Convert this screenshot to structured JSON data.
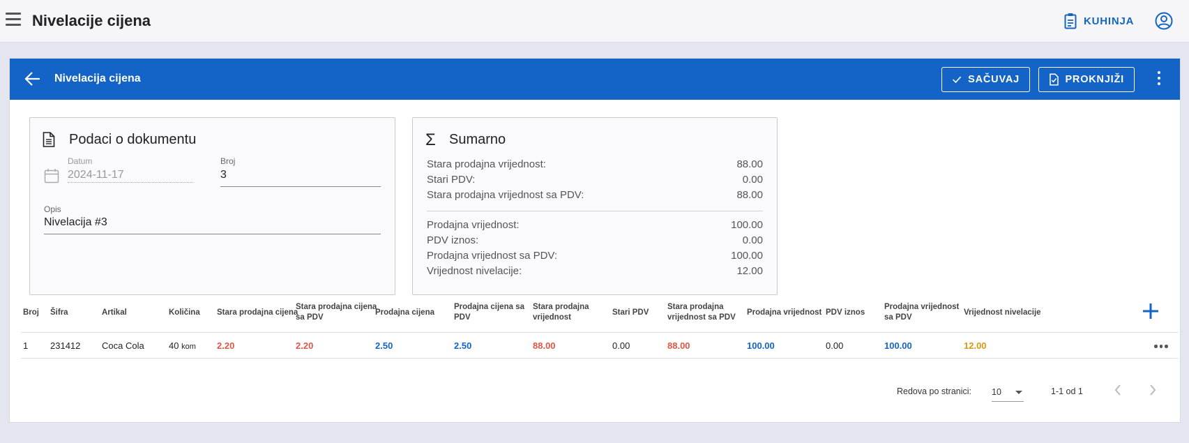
{
  "appbar": {
    "title": "Nivelacije cijena",
    "location_label": "KUHINJA",
    "icons": {
      "menu": "menu-icon",
      "location": "clipboard-icon",
      "account": "account-circle-icon"
    }
  },
  "toolbar": {
    "title": "Nivelacija cijena",
    "save_label": "SAČUVAJ",
    "post_label": "PROKNJIŽI",
    "icons": {
      "back": "arrow-left-icon",
      "save": "check-icon",
      "post": "document-check-icon",
      "more": "more-vertical-icon"
    }
  },
  "document": {
    "title": "Podaci o dokumentu",
    "date_label": "Datum",
    "date_value": "2024-11-17",
    "number_label": "Broj",
    "number_value": "3",
    "description_label": "Opis",
    "description_value": "Nivelacija #3"
  },
  "summary": {
    "title": "Sumarno",
    "rows_old": [
      {
        "label": "Stara prodajna vrijednost:",
        "value": "88.00"
      },
      {
        "label": "Stari PDV:",
        "value": "0.00"
      },
      {
        "label": "Stara prodajna vrijednost sa PDV:",
        "value": "88.00"
      }
    ],
    "rows_new": [
      {
        "label": "Prodajna vrijednost:",
        "value": "100.00"
      },
      {
        "label": "PDV iznos:",
        "value": "0.00"
      },
      {
        "label": "Prodajna vrijednost sa PDV:",
        "value": "100.00"
      },
      {
        "label": "Vrijednost nivelacije:",
        "value": "12.00"
      }
    ]
  },
  "table": {
    "headers": [
      [
        "Broj"
      ],
      [
        "Šifra"
      ],
      [
        "Artikal"
      ],
      [
        "Količina"
      ],
      [
        "Stara prodajna cijena"
      ],
      [
        "Stara prodajna cijena",
        "sa PDV"
      ],
      [
        "Prodajna cijena"
      ],
      [
        "Prodajna cijena sa",
        "PDV"
      ],
      [
        "Stara prodajna",
        "vrijednost"
      ],
      [
        "Stari PDV"
      ],
      [
        "Stara prodajna",
        "vrijednost sa PDV"
      ],
      [
        "Prodajna vrijednost"
      ],
      [
        "PDV iznos"
      ],
      [
        "Prodajna vrijednost",
        "sa PDV"
      ],
      [
        "Vrijednost nivelacije"
      ]
    ],
    "rows": [
      {
        "broj": "1",
        "sifra": "231412",
        "artikal": "Coca Cola",
        "kolicina": "40",
        "jedinica": "kom",
        "stara_cijena": "2.20",
        "stara_cijena_pdv": "2.20",
        "cijena": "2.50",
        "cijena_pdv": "2.50",
        "stara_vrijednost": "88.00",
        "stari_pdv": "0.00",
        "stara_vrijednost_pdv": "88.00",
        "vrijednost": "100.00",
        "pdv_iznos": "0.00",
        "vrijednost_pdv": "100.00",
        "nivelacija": "12.00"
      }
    ]
  },
  "pagination": {
    "rows_per_page_label": "Redova po stranici:",
    "rows_per_page": "10",
    "range": "1-1 od 1"
  },
  "colors": {
    "primary": "#1464c8",
    "old_value": "#e05545",
    "new_value": "#1464c8",
    "difference": "#d39a12"
  }
}
